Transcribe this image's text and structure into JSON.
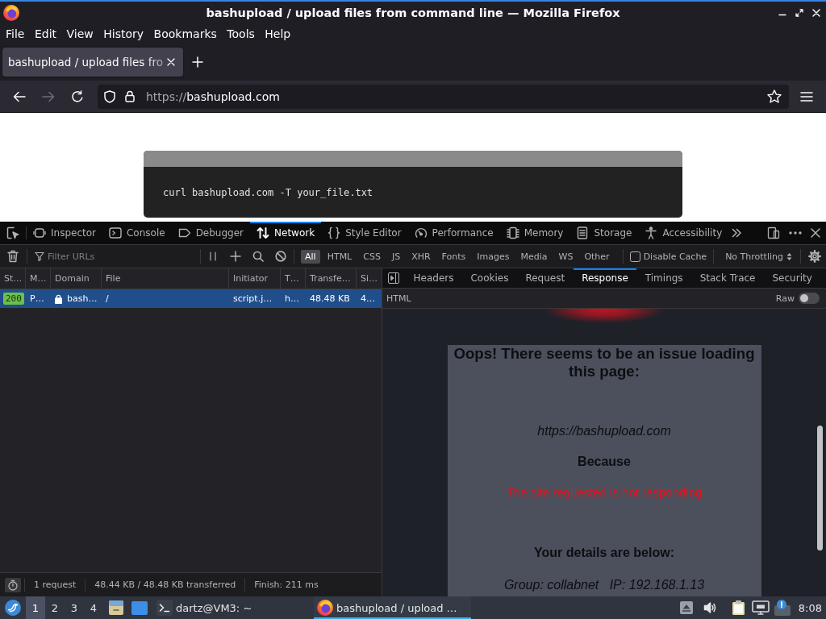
{
  "window": {
    "title": "bashupload / upload files from command line — Mozilla Firefox"
  },
  "menu": [
    "File",
    "Edit",
    "View",
    "History",
    "Bookmarks",
    "Tools",
    "Help"
  ],
  "tabs": [
    {
      "title": "bashupload / upload files fro",
      "selected": true
    }
  ],
  "navigation": {
    "back": {
      "disabled": false
    },
    "forward": {
      "disabled": true
    },
    "url_scheme": "https://",
    "url_host": "bashupload.com"
  },
  "page": {
    "command": "curl bashupload.com -T your_file.txt"
  },
  "devtools": {
    "tools": [
      {
        "kind": "inspector",
        "label": "Inspector",
        "selected": false
      },
      {
        "kind": "console",
        "label": "Console",
        "selected": false
      },
      {
        "kind": "debugger",
        "label": "Debugger",
        "selected": false
      },
      {
        "kind": "network",
        "label": "Network",
        "selected": true
      },
      {
        "kind": "style",
        "label": "Style Editor",
        "selected": false
      },
      {
        "kind": "performance",
        "label": "Performance",
        "selected": false
      },
      {
        "kind": "memory",
        "label": "Memory",
        "selected": false
      },
      {
        "kind": "storage",
        "label": "Storage",
        "selected": false
      },
      {
        "kind": "accessibility",
        "label": "Accessibility",
        "selected": false
      }
    ],
    "network": {
      "filter": {
        "placeholder": "Filter URLs"
      },
      "type_filters": [
        {
          "label": "All",
          "selected": true
        },
        {
          "label": "HTML",
          "selected": false
        },
        {
          "label": "CSS",
          "selected": false
        },
        {
          "label": "JS",
          "selected": false
        },
        {
          "label": "XHR",
          "selected": false
        },
        {
          "label": "Fonts",
          "selected": false
        },
        {
          "label": "Images",
          "selected": false
        },
        {
          "label": "Media",
          "selected": false
        },
        {
          "label": "WS",
          "selected": false
        },
        {
          "label": "Other",
          "selected": false
        }
      ],
      "disable_cache": {
        "label": "Disable Cache",
        "checked": false
      },
      "throttling": "No Throttling",
      "table": {
        "columns": [
          "St…",
          "M…",
          "Domain",
          "File",
          "Initiator",
          "T…",
          "Transfe…",
          "Si…"
        ],
        "rows": [
          {
            "selected": true,
            "secure": true,
            "cells": [
              "200",
              "P…",
              "bash…",
              "/",
              "script.j…",
              "h…",
              "48.48 KB",
              "4…"
            ]
          }
        ]
      },
      "status_bar": [
        "1 request",
        "48.44 KB / 48.48 KB transferred",
        "Finish: 211 ms"
      ]
    },
    "details": {
      "tabs": [
        {
          "label": "Headers",
          "selected": false
        },
        {
          "label": "Cookies",
          "selected": false
        },
        {
          "label": "Request",
          "selected": false
        },
        {
          "label": "Response",
          "selected": true
        },
        {
          "label": "Timings",
          "selected": false
        },
        {
          "label": "Stack Trace",
          "selected": false
        },
        {
          "label": "Security",
          "selected": false
        }
      ],
      "response_type": "HTML",
      "raw": {
        "label": "Raw",
        "on": false
      },
      "preview": {
        "heading": "Oops! There seems to be an issue loading this page:",
        "url": "https://bashupload.com",
        "because": "Because",
        "error": "The site requested is not responding",
        "details_heading": "Your details are below:",
        "details": "Group: collabnet   IP: 192.168.1.13"
      }
    }
  },
  "taskbar": {
    "workspaces": [
      {
        "label": "1",
        "selected": true
      },
      {
        "label": "2",
        "selected": false
      },
      {
        "label": "3",
        "selected": false
      },
      {
        "label": "4",
        "selected": false
      }
    ],
    "tasks": [
      {
        "kind": "terminal",
        "label": "dartz@VM3: ~",
        "selected": false
      },
      {
        "kind": "browser",
        "label": "bashupload / upload …",
        "selected": true
      }
    ],
    "clock": "8:08"
  }
}
